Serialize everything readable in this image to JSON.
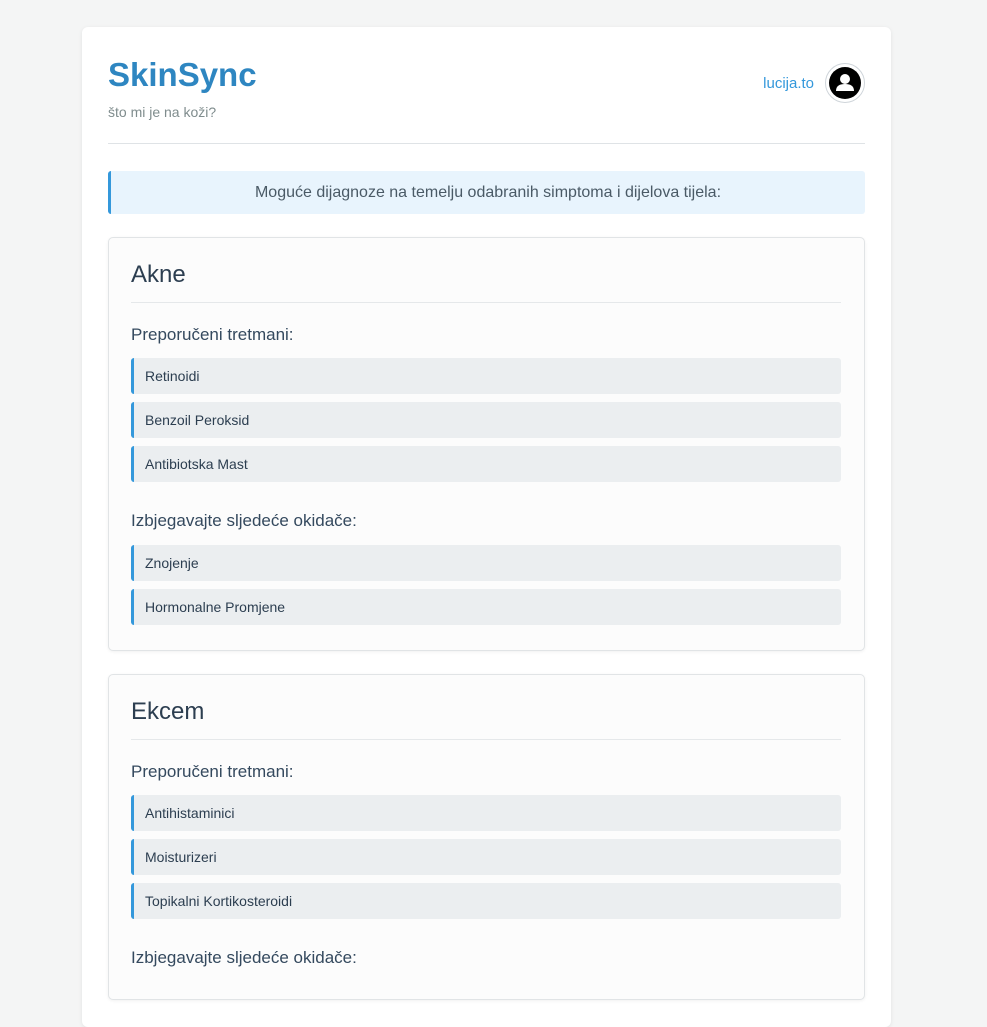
{
  "app": {
    "title": "SkinSync",
    "subtitle": "što mi je na koži?"
  },
  "user": {
    "name": "lucija.to",
    "avatar_icon": "user-icon"
  },
  "notice": {
    "text": "Moguće dijagnoze na temelju odabranih simptoma i dijelova tijela:"
  },
  "diagnoses": [
    {
      "name": "Akne",
      "treatments_heading": "Preporučeni tretmani:",
      "treatments": [
        "Retinoidi",
        "Benzoil Peroksid",
        "Antibiotska Mast"
      ],
      "triggers_heading": "Izbjegavajte sljedeće okidače:",
      "triggers": [
        "Znojenje",
        "Hormonalne Promjene"
      ]
    },
    {
      "name": "Ekcem",
      "treatments_heading": "Preporučeni tretmani:",
      "treatments": [
        "Antihistaminici",
        "Moisturizeri",
        "Topikalni Kortikosteroidi"
      ],
      "triggers_heading": "Izbjegavajte sljedeće okidače:",
      "triggers": []
    }
  ],
  "colors": {
    "accent": "#3498db",
    "brand": "#2e86c1",
    "notice_bg": "#e8f4fd",
    "item_bg": "#ebeef0"
  }
}
